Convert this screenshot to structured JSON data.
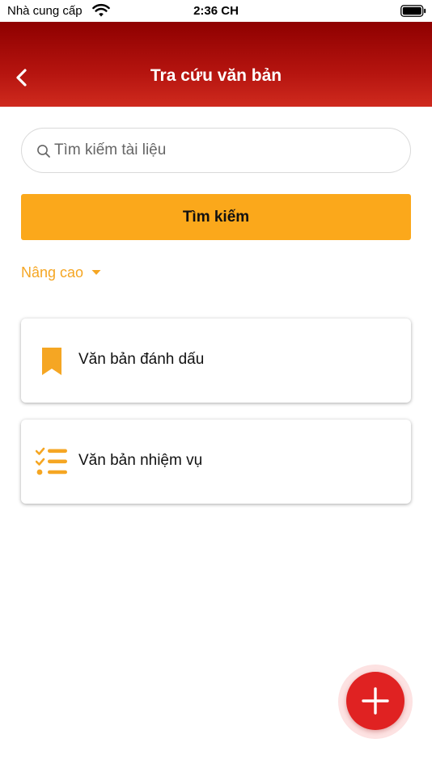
{
  "status_bar": {
    "carrier": "Nhà cung cấp",
    "time": "2:36 CH",
    "wifi_icon": "wifi-icon",
    "battery_icon": "battery-icon"
  },
  "header": {
    "title": "Tra cứu văn bản",
    "back_icon": "chevron-left-icon",
    "gradient": [
      "#8e0000",
      "#cf2a1e"
    ]
  },
  "search": {
    "placeholder": "Tìm kiếm tài liệu",
    "value": "",
    "icon": "search-icon",
    "button_label": "Tìm kiếm",
    "button_color": "#fba81b"
  },
  "advanced": {
    "label": "Nâng cao",
    "icon": "caret-down-icon",
    "color": "#f5a623"
  },
  "menu": [
    {
      "label": "Văn bản đánh dấu",
      "icon": "bookmark-icon"
    },
    {
      "label": "Văn bản nhiệm vụ",
      "icon": "checklist-icon"
    }
  ],
  "fab": {
    "icon": "plus-icon",
    "color": "#e02222"
  }
}
